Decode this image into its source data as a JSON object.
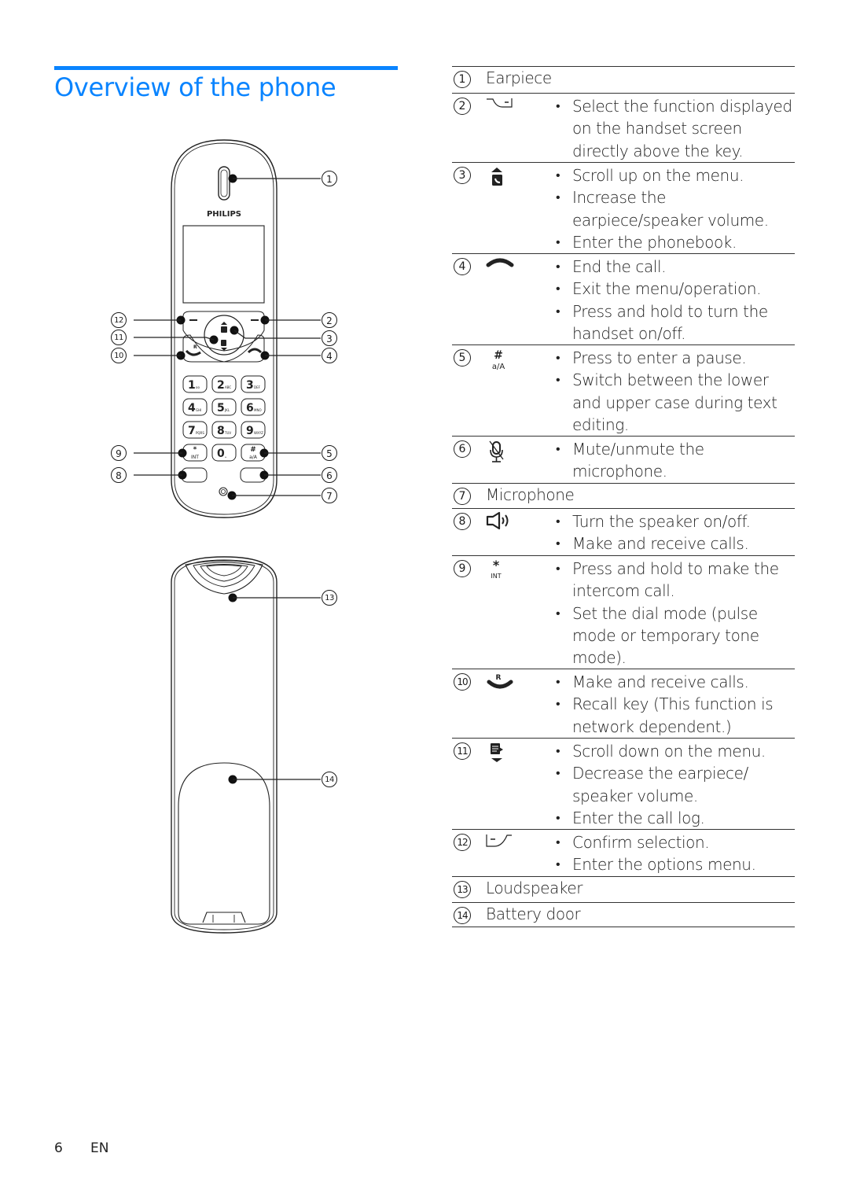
{
  "page": {
    "title": "Overview of the phone",
    "title_color": "#0a84ff",
    "page_number": "6",
    "language": "EN"
  },
  "figure": {
    "brand": "PHILIPS",
    "front_callouts": [
      "1",
      "2",
      "3",
      "4",
      "5",
      "6",
      "7",
      "8",
      "9",
      "10",
      "11",
      "12"
    ],
    "back_callouts": [
      "13",
      "14"
    ],
    "keypad": [
      {
        "digit": "1",
        "sub": "oo"
      },
      {
        "digit": "2",
        "sub": "ABC"
      },
      {
        "digit": "3",
        "sub": "DEF"
      },
      {
        "digit": "4",
        "sub": "GHI"
      },
      {
        "digit": "5",
        "sub": "JKL"
      },
      {
        "digit": "6",
        "sub": "MNO"
      },
      {
        "digit": "7",
        "sub": "PQRS"
      },
      {
        "digit": "8",
        "sub": "TUV"
      },
      {
        "digit": "9",
        "sub": "WXYZ"
      },
      {
        "digit": "*",
        "sub": "INT"
      },
      {
        "digit": "0",
        "sub": "␣"
      },
      {
        "digit": "#",
        "sub": "a/A"
      }
    ]
  },
  "parts": [
    {
      "number": "1",
      "label": "Earpiece",
      "icon": null,
      "items": []
    },
    {
      "number": "2",
      "label": null,
      "icon": "right-softkey-icon",
      "items": [
        "Select the function displayed on the handset screen directly above the key."
      ]
    },
    {
      "number": "3",
      "label": null,
      "icon": "scroll-up-phonebook-icon",
      "items": [
        "Scroll up on the menu.",
        "Increase the earpiece/speaker volume.",
        "Enter the phonebook."
      ]
    },
    {
      "number": "4",
      "label": null,
      "icon": "end-call-icon",
      "items": [
        "End the call.",
        "Exit the menu/operation.",
        "Press and hold to turn the handset on/off."
      ]
    },
    {
      "number": "5",
      "label": null,
      "icon": "hash-aA-icon",
      "icon_text": {
        "top": "#",
        "bottom": "a/A"
      },
      "items": [
        "Press to enter a pause.",
        "Switch between the lower and upper case during text editing."
      ]
    },
    {
      "number": "6",
      "label": null,
      "icon": "mute-microphone-icon",
      "items": [
        "Mute/unmute the microphone."
      ]
    },
    {
      "number": "7",
      "label": "Microphone",
      "icon": null,
      "items": []
    },
    {
      "number": "8",
      "label": null,
      "icon": "speaker-icon",
      "items": [
        "Turn the speaker on/off.",
        "Make and receive calls."
      ]
    },
    {
      "number": "9",
      "label": null,
      "icon": "star-int-icon",
      "icon_text": {
        "top": "*",
        "bottom": "INT"
      },
      "items": [
        "Press and hold to make the intercom call.",
        "Set the dial mode (pulse mode or temporary tone mode)."
      ]
    },
    {
      "number": "10",
      "label": null,
      "icon": "talk-recall-icon",
      "icon_text": {
        "top": "R"
      },
      "items": [
        "Make and receive calls.",
        "Recall key (This function is network dependent.)"
      ]
    },
    {
      "number": "11",
      "label": null,
      "icon": "scroll-down-calllog-icon",
      "items": [
        "Scroll down on the menu.",
        "Decrease the earpiece/ speaker volume.",
        "Enter the call log."
      ]
    },
    {
      "number": "12",
      "label": null,
      "icon": "left-softkey-icon",
      "items": [
        "Confirm selection.",
        "Enter the options menu."
      ]
    },
    {
      "number": "13",
      "label": "Loudspeaker",
      "icon": null,
      "items": []
    },
    {
      "number": "14",
      "label": "Battery door",
      "icon": null,
      "items": []
    }
  ]
}
